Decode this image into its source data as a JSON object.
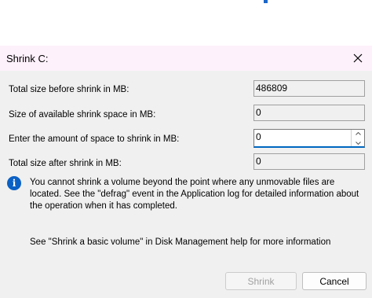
{
  "dialog": {
    "title": "Shrink C:",
    "rows": [
      {
        "label": "Total size before shrink in MB:",
        "value": "486809"
      },
      {
        "label": "Size of available shrink space in MB:",
        "value": "0"
      },
      {
        "label": "Enter the amount of space to shrink in MB:",
        "value": "0"
      },
      {
        "label": "Total size after shrink in MB:",
        "value": "0"
      }
    ],
    "info_text": "You cannot shrink a volume beyond the point where any unmovable files are located. See the \"defrag\" event in the Application log for detailed information about the operation when it has completed.",
    "help_text": "See \"Shrink a basic volume\" in Disk Management help for more information",
    "buttons": {
      "shrink": "Shrink",
      "cancel": "Cancel"
    }
  },
  "icons": {
    "close": "close-icon",
    "info": "info-icon",
    "spin_up": "chevron-up-icon",
    "spin_down": "chevron-down-icon"
  },
  "colors": {
    "accent": "#0067c0",
    "info": "#0b61c4",
    "titlebar": "#fdf1fb",
    "dialog_bg": "#f0f0f0"
  }
}
